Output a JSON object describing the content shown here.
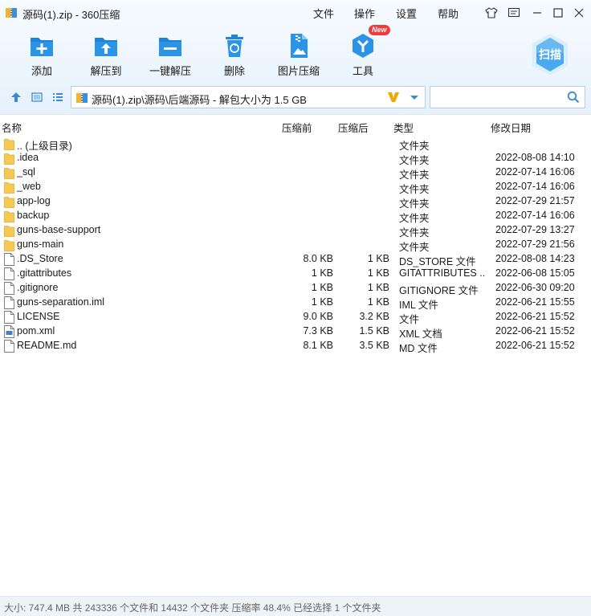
{
  "window": {
    "title": "源码(1).zip - 360压缩"
  },
  "menu": [
    "文件",
    "操作",
    "设置",
    "帮助"
  ],
  "toolbar": {
    "tools": [
      {
        "label": "添加",
        "icon": "add-icon"
      },
      {
        "label": "解压到",
        "icon": "extract-to-icon"
      },
      {
        "label": "一键解压",
        "icon": "one-click-extract-icon"
      },
      {
        "label": "删除",
        "icon": "delete-icon"
      },
      {
        "label": "图片压缩",
        "icon": "image-compress-icon"
      },
      {
        "label": "工具",
        "icon": "tools-icon",
        "badge": "New"
      }
    ],
    "scan_label": "扫描"
  },
  "address": {
    "path": "源码(1).zip\\源码\\后端源码 - 解包大小为 1.5 GB"
  },
  "search": {
    "value": "",
    "placeholder": ""
  },
  "columns": {
    "name": "名称",
    "original": "压缩前",
    "compressed": "压缩后",
    "type": "类型",
    "modified": "修改日期"
  },
  "files": [
    {
      "name": ".. (上级目录)",
      "original": "",
      "compressed": "",
      "type": "文件夹",
      "modified": "",
      "kind": "folder"
    },
    {
      "name": ".idea",
      "original": "",
      "compressed": "",
      "type": "文件夹",
      "modified": "2022-08-08 14:10",
      "kind": "folder"
    },
    {
      "name": "_sql",
      "original": "",
      "compressed": "",
      "type": "文件夹",
      "modified": "2022-07-14 16:06",
      "kind": "folder"
    },
    {
      "name": "_web",
      "original": "",
      "compressed": "",
      "type": "文件夹",
      "modified": "2022-07-14 16:06",
      "kind": "folder"
    },
    {
      "name": "app-log",
      "original": "",
      "compressed": "",
      "type": "文件夹",
      "modified": "2022-07-29 21:57",
      "kind": "folder"
    },
    {
      "name": "backup",
      "original": "",
      "compressed": "",
      "type": "文件夹",
      "modified": "2022-07-14 16:06",
      "kind": "folder"
    },
    {
      "name": "guns-base-support",
      "original": "",
      "compressed": "",
      "type": "文件夹",
      "modified": "2022-07-29 13:27",
      "kind": "folder"
    },
    {
      "name": "guns-main",
      "original": "",
      "compressed": "",
      "type": "文件夹",
      "modified": "2022-07-29 21:56",
      "kind": "folder"
    },
    {
      "name": ".DS_Store",
      "original": "8.0 KB",
      "compressed": "1 KB",
      "type": "DS_STORE 文件",
      "modified": "2022-08-08 14:23",
      "kind": "file"
    },
    {
      "name": ".gitattributes",
      "original": "1 KB",
      "compressed": "1 KB",
      "type": "GITATTRIBUTES ...",
      "modified": "2022-06-08 15:05",
      "kind": "file"
    },
    {
      "name": ".gitignore",
      "original": "1 KB",
      "compressed": "1 KB",
      "type": "GITIGNORE 文件",
      "modified": "2022-06-30 09:20",
      "kind": "file"
    },
    {
      "name": "guns-separation.iml",
      "original": "1 KB",
      "compressed": "1 KB",
      "type": "IML 文件",
      "modified": "2022-06-21 15:55",
      "kind": "file"
    },
    {
      "name": "LICENSE",
      "original": "9.0 KB",
      "compressed": "3.2 KB",
      "type": "文件",
      "modified": "2022-06-21 15:52",
      "kind": "file"
    },
    {
      "name": "pom.xml",
      "original": "7.3 KB",
      "compressed": "1.5 KB",
      "type": "XML 文档",
      "modified": "2022-06-21 15:52",
      "kind": "xml"
    },
    {
      "name": "README.md",
      "original": "8.1 KB",
      "compressed": "3.5 KB",
      "type": "MD 文件",
      "modified": "2022-06-21 15:52",
      "kind": "file"
    }
  ],
  "status": {
    "text": "大小: 747.4 MB 共 243336 个文件和 14432 个文件夹 压缩率 48.4% 已经选择 1 个文件夹"
  },
  "colors": {
    "accent": "#2b8fe0",
    "folder": "#f7c952",
    "toolbar_bg": "#e8f2fc"
  }
}
